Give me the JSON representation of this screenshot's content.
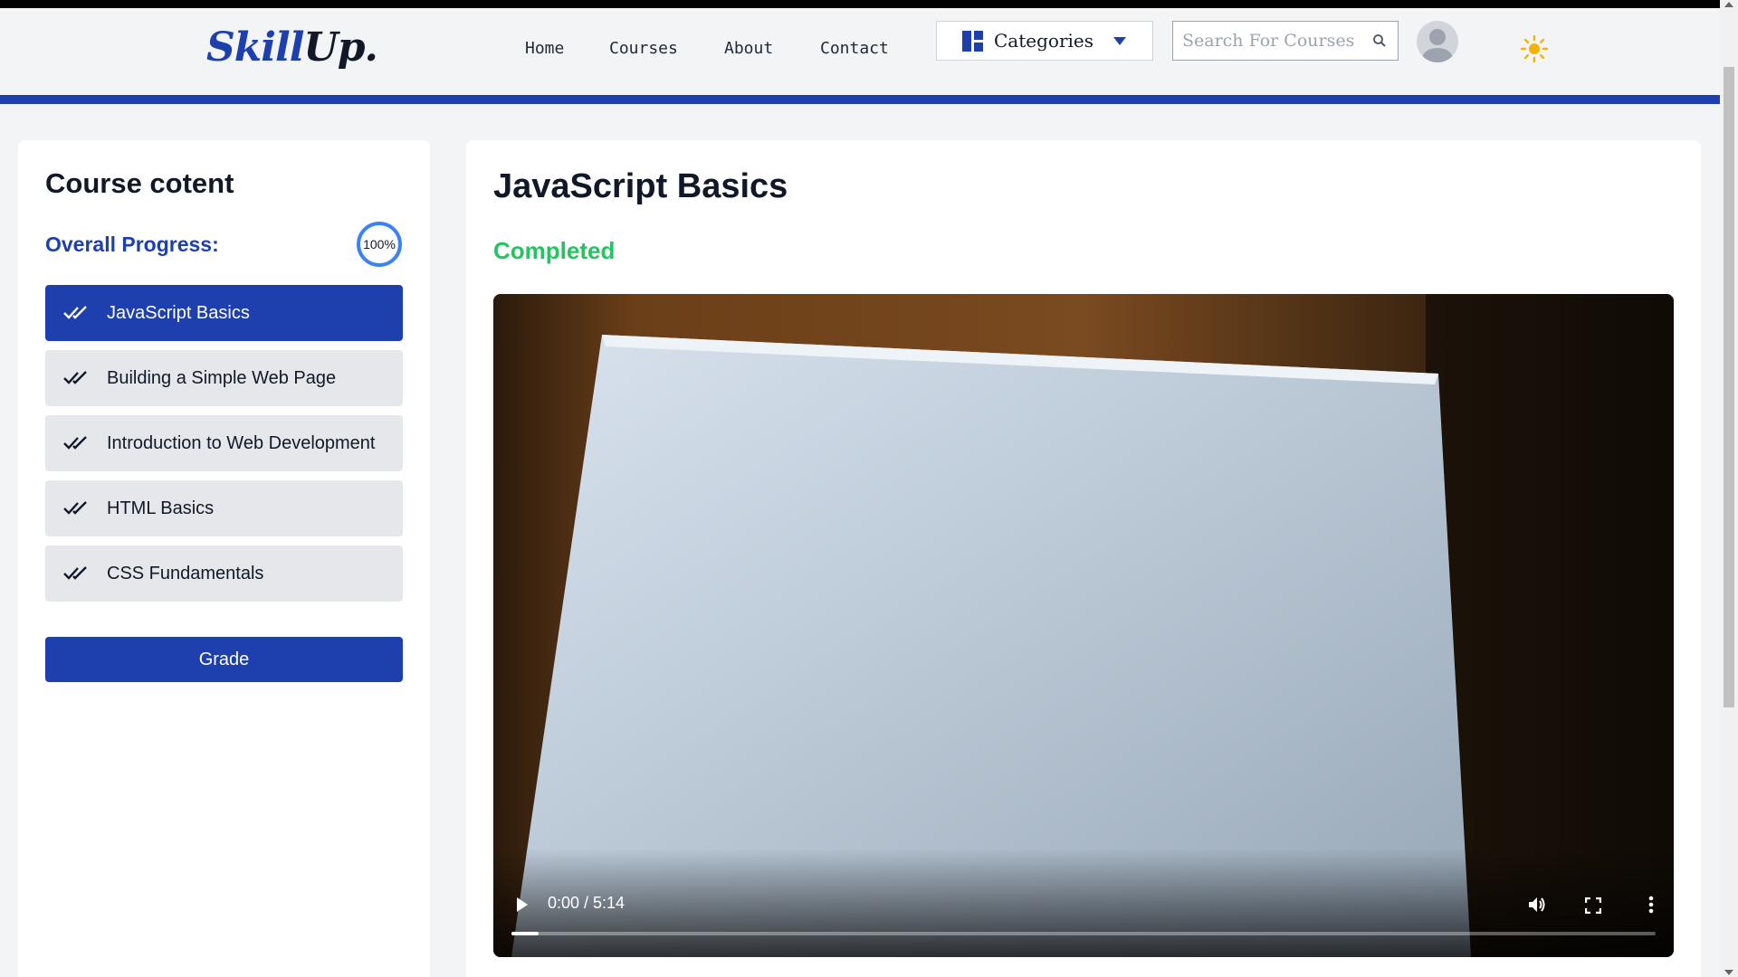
{
  "header": {
    "logo_part1": "Skill",
    "logo_part2": "Up.",
    "nav": [
      "Home",
      "Courses",
      "About",
      "Contact"
    ],
    "categories_label": "Categories",
    "search_placeholder": "Search For Courses"
  },
  "sidebar": {
    "title": "Course cotent",
    "progress_label": "Overall Progress:",
    "progress_value": "100%",
    "lessons": [
      "JavaScript Basics",
      "Building a Simple Web Page",
      "Introduction to Web Development",
      "HTML Basics",
      "CSS Fundamentals"
    ],
    "active_lesson_index": 0,
    "grade_button": "Grade"
  },
  "main": {
    "title": "JavaScript Basics",
    "status": "Completed",
    "video": {
      "time": "0:00 / 5:14"
    }
  },
  "colors": {
    "brand": "#1e40af",
    "status_completed": "#22c55e",
    "progress_ring": "#3b82f6",
    "sun": "#f5b301"
  }
}
